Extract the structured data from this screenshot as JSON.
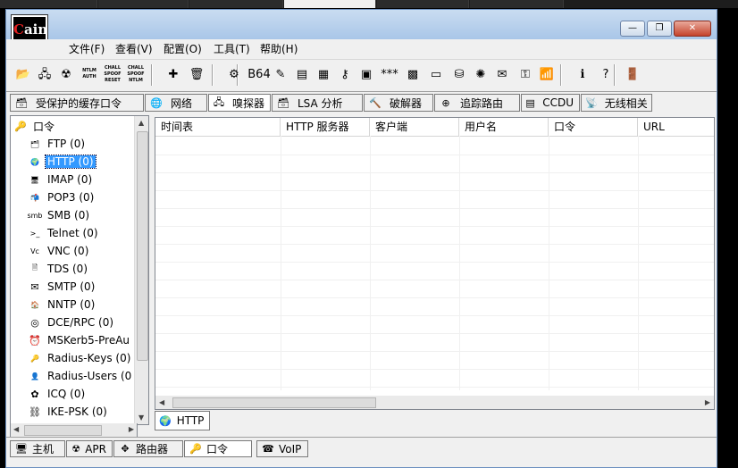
{
  "app": {
    "title_icon_text_c": "C",
    "title_icon_text_rest": "ain"
  },
  "window_controls": {
    "minimize": "—",
    "restore": "❐",
    "close": "✕"
  },
  "menu": [
    "文件(F)",
    "查看(V)",
    "配置(O)",
    "工具(T)",
    "帮助(H)"
  ],
  "toolbar": {
    "buttons": [
      {
        "icon": "open-folder-icon",
        "glyph": "📂"
      },
      {
        "icon": "network-sniffer-icon",
        "glyph": "🖧"
      },
      {
        "icon": "apr-poison-icon",
        "glyph": "☢"
      },
      {
        "icon": "ntlm-auth-icon",
        "glyph": "NTLM AUTH"
      },
      {
        "icon": "chall-spoof-reset-icon",
        "glyph": "CHALL SPOOF RESET"
      },
      {
        "icon": "chall-spoof-ntlm-icon",
        "glyph": "CHALL SPOOF NTLM"
      },
      {
        "icon": "add-icon",
        "glyph": "✚"
      },
      {
        "icon": "delete-icon",
        "glyph": "🗑"
      },
      {
        "icon": "decoder-icon",
        "glyph": "⚙"
      },
      {
        "icon": "base64-icon",
        "glyph": "B64"
      },
      {
        "icon": "hash-calculator-icon",
        "glyph": "✎"
      },
      {
        "icon": "pwl-icon",
        "glyph": "▤"
      },
      {
        "icon": "vpn-icon",
        "glyph": "▦"
      },
      {
        "icon": "key-icon",
        "glyph": "⚷"
      },
      {
        "icon": "vnc-decoder-icon",
        "glyph": "▣"
      },
      {
        "icon": "password-reveal-icon",
        "glyph": "***"
      },
      {
        "icon": "box-icon",
        "glyph": "▩"
      },
      {
        "icon": "hardware-icon",
        "glyph": "▭"
      },
      {
        "icon": "packet-icon",
        "glyph": "⛁"
      },
      {
        "icon": "globe-icon",
        "glyph": "✺"
      },
      {
        "icon": "certificate-icon",
        "glyph": "✉"
      },
      {
        "icon": "lock-icon",
        "glyph": "⚿"
      },
      {
        "icon": "wireless-icon",
        "glyph": "📶"
      },
      {
        "icon": "info-icon",
        "glyph": "ℹ"
      },
      {
        "icon": "help-icon",
        "glyph": "?"
      },
      {
        "icon": "exit-icon",
        "glyph": "🚪"
      }
    ]
  },
  "main_tabs": [
    {
      "label": "受保护的缓存口令",
      "icon": "protected-cache-icon",
      "glyph": "🗃"
    },
    {
      "label": "网络",
      "icon": "network-icon",
      "glyph": "🌐"
    },
    {
      "label": "嗅探器",
      "icon": "sniffer-icon",
      "glyph": "🖧"
    },
    {
      "label": "LSA 分析",
      "icon": "lsa-icon",
      "glyph": "🗃"
    },
    {
      "label": "破解器",
      "icon": "cracker-icon",
      "glyph": "🔨"
    },
    {
      "label": "追踪路由",
      "icon": "traceroute-icon",
      "glyph": "⊕"
    },
    {
      "label": "CCDU",
      "icon": "ccdu-icon",
      "glyph": "▤"
    },
    {
      "label": "无线相关",
      "icon": "wireless-tab-icon",
      "glyph": "📡"
    }
  ],
  "tree": {
    "root": "口令",
    "items": [
      {
        "label": "FTP (0)",
        "icon": "ftp-icon",
        "glyph": "🗂"
      },
      {
        "label": "HTTP (0)",
        "icon": "http-icon",
        "glyph": "🌍"
      },
      {
        "label": "IMAP (0)",
        "icon": "imap-icon",
        "glyph": "🖥"
      },
      {
        "label": "POP3 (0)",
        "icon": "pop3-icon",
        "glyph": "📬"
      },
      {
        "label": "SMB (0)",
        "icon": "smb-icon",
        "glyph": "smb"
      },
      {
        "label": "Telnet (0)",
        "icon": "telnet-icon",
        "glyph": ">_"
      },
      {
        "label": "VNC (0)",
        "icon": "vnc-icon",
        "glyph": "Vc"
      },
      {
        "label": "TDS (0)",
        "icon": "tds-icon",
        "glyph": "🗎"
      },
      {
        "label": "SMTP (0)",
        "icon": "smtp-icon",
        "glyph": "✉"
      },
      {
        "label": "NNTP (0)",
        "icon": "nntp-icon",
        "glyph": "🏠"
      },
      {
        "label": "DCE/RPC (0)",
        "icon": "dcerpc-icon",
        "glyph": "◎"
      },
      {
        "label": "MSKerb5-PreAu",
        "icon": "kerberos-icon",
        "glyph": "⏰"
      },
      {
        "label": "Radius-Keys (0)",
        "icon": "radius-keys-icon",
        "glyph": "🔑"
      },
      {
        "label": "Radius-Users (0",
        "icon": "radius-users-icon",
        "glyph": "👤"
      },
      {
        "label": "ICQ (0)",
        "icon": "icq-icon",
        "glyph": "✿"
      },
      {
        "label": "IKE-PSK (0)",
        "icon": "ike-psk-icon",
        "glyph": "⛓"
      }
    ]
  },
  "table": {
    "columns": [
      "时间表",
      "HTTP 服务器",
      "客户端",
      "用户名",
      "口令",
      "URL"
    ]
  },
  "subtab": "HTTP",
  "bottom_tabs": [
    {
      "label": "主机",
      "icon": "host-icon",
      "glyph": "🖥"
    },
    {
      "label": "APR",
      "icon": "apr-icon",
      "glyph": "☢"
    },
    {
      "label": "路由器",
      "icon": "router-icon",
      "glyph": "✥"
    },
    {
      "label": "口令",
      "icon": "password-tab-icon",
      "glyph": "🔑"
    },
    {
      "label": "VoIP",
      "icon": "voip-icon",
      "glyph": "☎"
    }
  ],
  "colors": {
    "selection": "#3399ff",
    "titlebar": "#b9d1ea",
    "close": "#c5432b"
  }
}
